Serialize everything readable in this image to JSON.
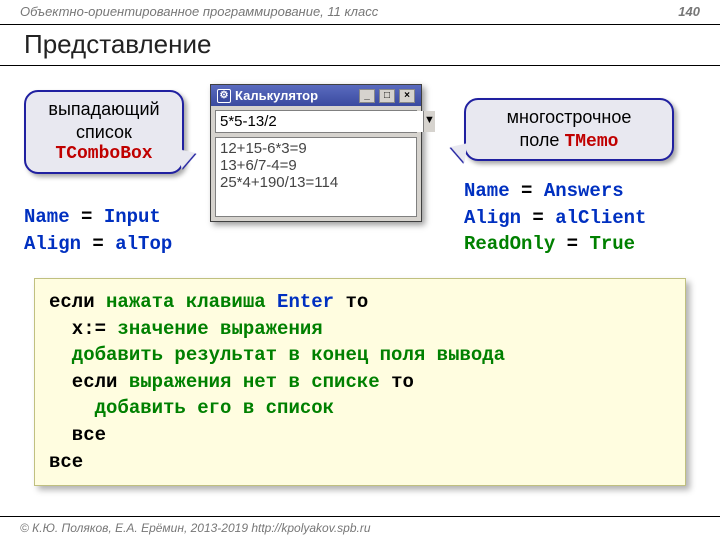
{
  "header": {
    "course": "Объектно-ориентированное программирование, 11 класс",
    "page": "140"
  },
  "title": "Представление",
  "callout_left": {
    "line1": "выпадающий",
    "line2": "список",
    "klass": "TComboBox"
  },
  "callout_right": {
    "line1": "многострочное",
    "line2_pre": "поле ",
    "klass": "TMemo"
  },
  "props_left": {
    "l1a": "Name",
    "l1b": " = ",
    "l1c": "Input",
    "l2a": "Align",
    "l2b": " = ",
    "l2c": "alTop"
  },
  "props_right": {
    "l1a": "Name",
    "l1b": " = ",
    "l1c": "Answers",
    "l2a": "Align",
    "l2b": " = ",
    "l2c": "alClient",
    "l3a": "ReadOnly",
    "l3b": " = ",
    "l3c": "True"
  },
  "calc": {
    "title": "Калькулятор",
    "input": "5*5-13/2",
    "memo": "12+15-6*3=9\n13+6/7-4=9\n25*4+190/13=114",
    "min": "_",
    "max": "□",
    "close": "×",
    "drop": "▼",
    "icon": "⚙"
  },
  "code": {
    "l1a": "если ",
    "l1b": "нажата клавиша ",
    "l1c": "Enter ",
    "l1d": "то",
    "l2a": "  x:= ",
    "l2b": "значение выражения",
    "l3": "  добавить результат в конец поля вывода",
    "l4a": "  если ",
    "l4b": "выражения нет в списке ",
    "l4c": "то",
    "l5": "    добавить его в список",
    "l6": "  все",
    "l7": "все"
  },
  "footer": "© К.Ю. Поляков, Е.А. Ерёмин, 2013-2019     http://kpolyakov.spb.ru"
}
